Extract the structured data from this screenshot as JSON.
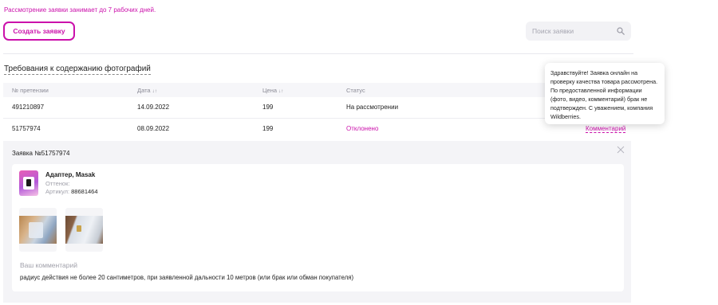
{
  "notice": "Рассмотрение заявки занимает до 7 рабочих дней.",
  "create_button": "Создать заявку",
  "search": {
    "placeholder": "Поиск заявки",
    "icon": "search-icon"
  },
  "requirements_link": "Требования к содержанию фотографий",
  "table": {
    "headers": {
      "claim_no": "№ претензии",
      "date": "Дата",
      "price": "Цена",
      "status": "Статус",
      "sort_icon": "↓↑"
    },
    "rows": [
      {
        "claim_no": "491210897",
        "date": "14.09.2022",
        "price": "199",
        "status": "На рассмотрении",
        "action": ""
      },
      {
        "claim_no": "51757974",
        "date": "08.09.2022",
        "price": "199",
        "status": "Отклонено",
        "action": "Комментарий"
      }
    ]
  },
  "tooltip": "Здравствуйте! Заявка онлайн на проверку качества товара рассмотрена. По предоставленной информации (фото, видео, комментарий) брак не подтвержден. С уважением, компания Wildberries.",
  "detail": {
    "title": "Заявка №51757974",
    "product": {
      "name": "Адаптер, Masak",
      "shade_label": "Оттенок:",
      "article_label": "Артикул:",
      "article_value": "88681464"
    },
    "comment_label": "Ваш комментарий",
    "comment_text": "радиус действия не более 20 сантиметров, при заявленной дальности 10 метров (или брак или обман покупателя)"
  },
  "colors": {
    "accent": "#cb11ab",
    "muted": "#a0a0aa",
    "panel": "#f4f4f7"
  }
}
